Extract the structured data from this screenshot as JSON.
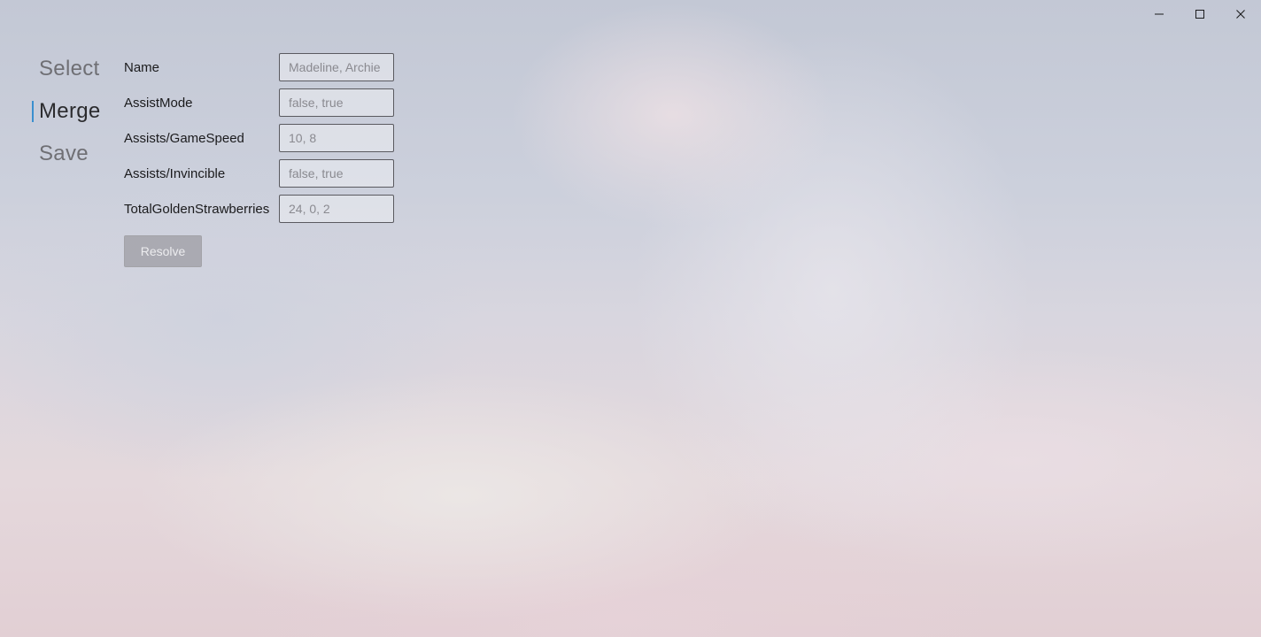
{
  "window": {
    "controls": [
      {
        "name": "minimize-button",
        "icon": "minimize-icon"
      },
      {
        "name": "maximize-button",
        "icon": "maximize-icon"
      },
      {
        "name": "close-button",
        "icon": "close-icon"
      }
    ]
  },
  "nav": {
    "items": [
      {
        "label": "Select",
        "active": false
      },
      {
        "label": "Merge",
        "active": true
      },
      {
        "label": "Save",
        "active": false
      }
    ],
    "accent_color": "#3a8fcf"
  },
  "form": {
    "fields": [
      {
        "label": "Name",
        "placeholder": "Madeline, Archie",
        "value": ""
      },
      {
        "label": "AssistMode",
        "placeholder": "false, true",
        "value": ""
      },
      {
        "label": "Assists/GameSpeed",
        "placeholder": "10, 8",
        "value": ""
      },
      {
        "label": "Assists/Invincible",
        "placeholder": "false, true",
        "value": ""
      },
      {
        "label": "TotalGoldenStrawberries",
        "placeholder": "24, 0, 2",
        "value": ""
      }
    ],
    "resolve_label": "Resolve",
    "resolve_enabled": false
  }
}
